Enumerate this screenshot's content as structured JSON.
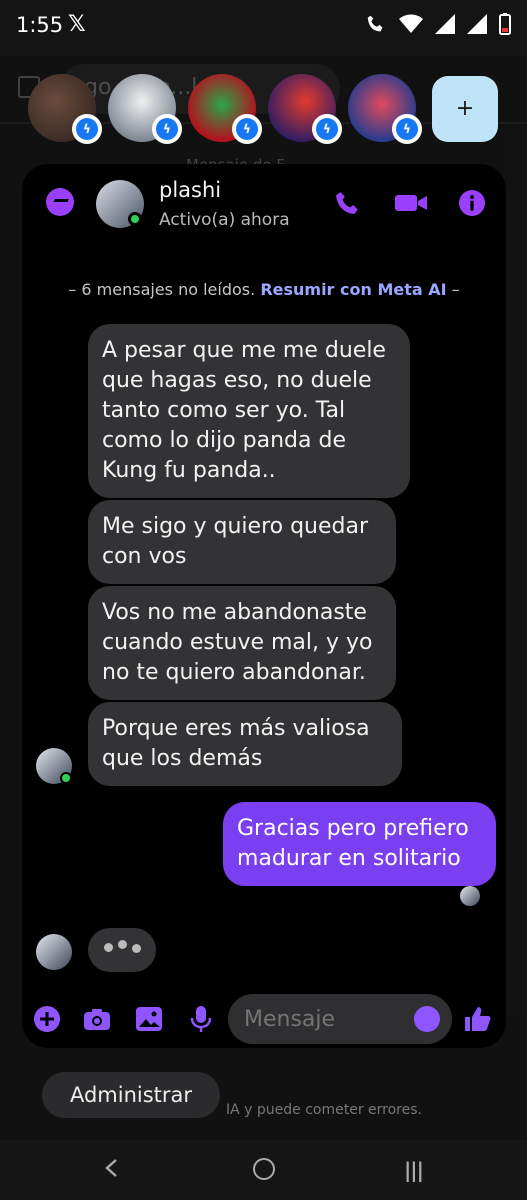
{
  "status_bar": {
    "time": "1:55",
    "notification_icon": "x-logo-icon",
    "icons": [
      "wifi-calling-icon",
      "wifi-icon",
      "signal-icon",
      "signal-icon",
      "battery-icon"
    ]
  },
  "background_browser": {
    "url_text": "go...i.co...le. E",
    "tab_text": "Mensaje de F..."
  },
  "chat_heads": {
    "badge_icon": "messenger-badge-icon",
    "count": 5,
    "new_chat_label": "+"
  },
  "chat": {
    "contact_name": "plashi",
    "contact_status": "Activo(a) ahora",
    "header_icons": [
      "messenger-icon",
      "phone-icon",
      "video-camera-icon",
      "info-icon"
    ],
    "unread_text": "6 mensajes no leídos.",
    "summarize_link": "Resumir con Meta AI",
    "messages": [
      {
        "direction": "in",
        "text": "A pesar que me me duele que hagas eso, no duele tanto como ser yo. Tal como lo dijo panda de Kung fu panda.."
      },
      {
        "direction": "in",
        "text": "Me sigo y quiero quedar con vos"
      },
      {
        "direction": "in",
        "text": "Vos no me abandonaste cuando estuve mal, y yo no te quiero abandonar."
      },
      {
        "direction": "in",
        "text": "Porque eres más valiosa que los demás"
      },
      {
        "direction": "out",
        "text": "Gracias pero prefiero madurar en solitario"
      }
    ],
    "composer": {
      "placeholder": "Mensaje",
      "icons": [
        "plus-icon",
        "camera-icon",
        "gallery-icon",
        "microphone-icon",
        "emoji-icon",
        "like-icon"
      ]
    }
  },
  "footer": {
    "admin_label": "Administrar",
    "disclaimer": "IA y puede cometer errores."
  },
  "colors": {
    "accent": "#7b3ff2",
    "incoming_bubble": "#333336",
    "panel_background": "#000000",
    "link": "#9aa6ff"
  }
}
